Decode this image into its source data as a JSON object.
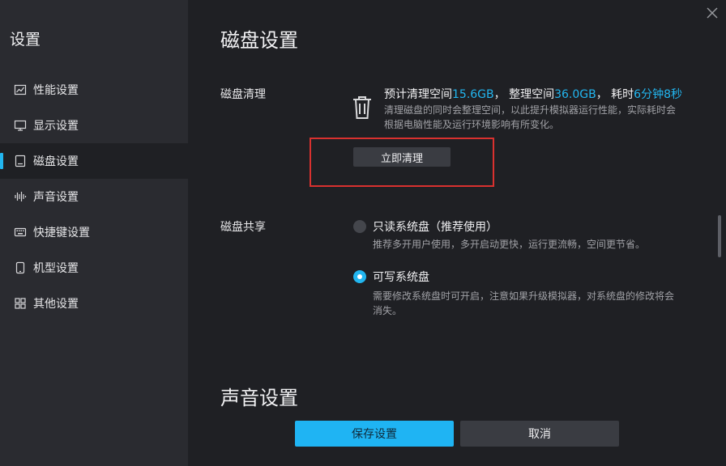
{
  "sidebar": {
    "title": "设置",
    "items": [
      {
        "label": "性能设置",
        "icon": "performance-chart-icon"
      },
      {
        "label": "显示设置",
        "icon": "monitor-icon"
      },
      {
        "label": "磁盘设置",
        "icon": "disk-icon",
        "active": true
      },
      {
        "label": "声音设置",
        "icon": "sound-wave-icon"
      },
      {
        "label": "快捷键设置",
        "icon": "keyboard-icon"
      },
      {
        "label": "机型设置",
        "icon": "phone-icon"
      },
      {
        "label": "其他设置",
        "icon": "grid-icon"
      }
    ]
  },
  "main": {
    "title": "磁盘设置",
    "disk_clean": {
      "label": "磁盘清理",
      "estimated_prefix": "预计清理空间",
      "estimated_value": "15.6GB",
      "sep1": "，  ",
      "organize_prefix": "整理空间",
      "organize_value": "36.0GB",
      "sep2": "，  ",
      "time_prefix": "耗时",
      "time_value": "6分钟8秒",
      "desc_line1": "清理磁盘的同时会整理空间，以此提升模拟器运行性能，实际耗时会",
      "desc_line2": "根据电脑性能及运行环境影响有所变化。",
      "button": "立即清理"
    },
    "disk_share": {
      "label": "磁盘共享",
      "options": [
        {
          "label": "只读系统盘（推荐使用）",
          "desc_line1": "推荐多开用户使用，多开启动更快，运行更流畅，空间更节省。",
          "desc_line2": "",
          "selected": false
        },
        {
          "label": "可写系统盘",
          "desc_line1": "需要修改系统盘时可开启，注意如果升级模拟器，对系统盘的修改将会",
          "desc_line2": "消失。",
          "selected": true
        }
      ]
    },
    "next_section_title": "声音设置"
  },
  "footer": {
    "save": "保存设置",
    "cancel": "取消"
  },
  "colors": {
    "accent": "#22b6f0",
    "highlight_box": "#d9312f",
    "sidebar_bg": "#2a2b30",
    "main_bg": "#1f2024"
  }
}
